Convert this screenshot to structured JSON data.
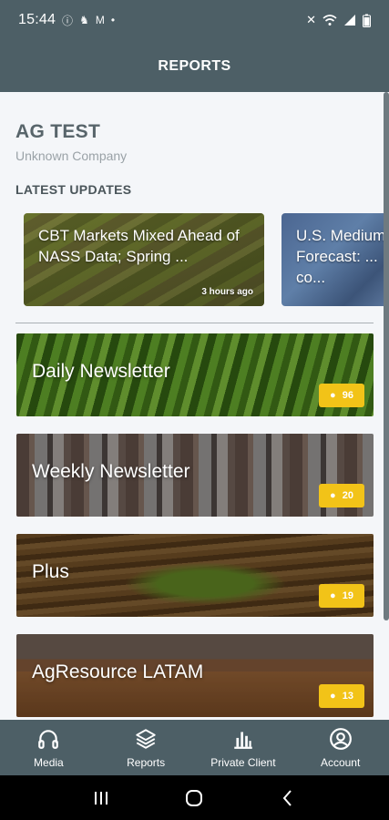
{
  "status_bar": {
    "time": "15:44",
    "left_icons": [
      "alarm-icon",
      "notification-icon",
      "mail-icon",
      "dot-icon"
    ],
    "right_icons": [
      "mute-icon",
      "wifi-icon",
      "signal-icon",
      "battery-icon"
    ]
  },
  "app_bar": {
    "title": "REPORTS"
  },
  "profile": {
    "name": "AG TEST",
    "company": "Unknown Company"
  },
  "latest_updates": {
    "title": "LATEST UPDATES",
    "cards": [
      {
        "headline": "CBT Markets Mixed Ahead of NASS Data; Spring ...",
        "time": "3 hours ago"
      },
      {
        "headline": "U.S. Medium Forecast: ... co...",
        "time": ""
      }
    ]
  },
  "reports": [
    {
      "label": "Daily Newsletter",
      "count": "96"
    },
    {
      "label": "Weekly Newsletter",
      "count": "20"
    },
    {
      "label": "Plus",
      "count": "19"
    },
    {
      "label": "AgResource LATAM",
      "count": "13"
    }
  ],
  "bottom_nav": [
    {
      "label": "Media",
      "icon": "headphones-icon"
    },
    {
      "label": "Reports",
      "icon": "layers-icon"
    },
    {
      "label": "Private Client",
      "icon": "bar-chart-icon"
    },
    {
      "label": "Account",
      "icon": "account-icon"
    }
  ],
  "colors": {
    "primary": "#4d5f66",
    "badge": "#f2c318",
    "background": "#f4f6f9"
  }
}
